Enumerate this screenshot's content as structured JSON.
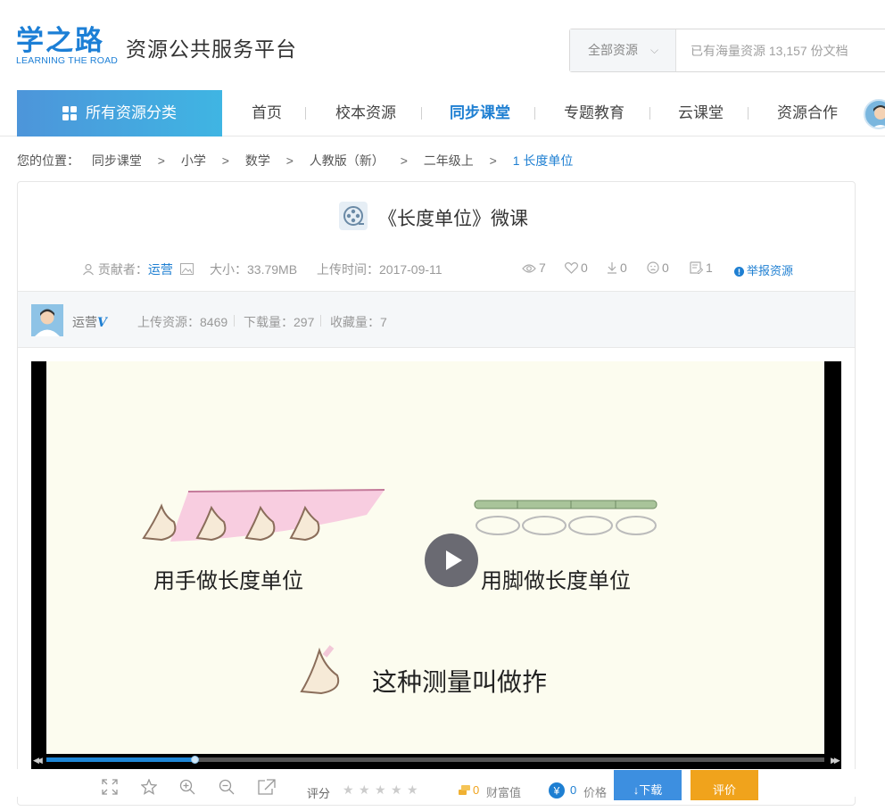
{
  "header": {
    "logo_cn": "学之路",
    "logo_en": "LEARNING THE ROAD",
    "platform_name": "资源公共服务平台",
    "search": {
      "scope": "全部资源",
      "placeholder": "已有海量资源 13,157 份文档"
    }
  },
  "nav": {
    "all_categories": "所有资源分类",
    "items": [
      {
        "label": "首页",
        "active": false
      },
      {
        "label": "校本资源",
        "active": false
      },
      {
        "label": "同步课堂",
        "active": true
      },
      {
        "label": "专题教育",
        "active": false
      },
      {
        "label": "云课堂",
        "active": false
      },
      {
        "label": "资源合作",
        "active": false
      }
    ]
  },
  "breadcrumb": {
    "prefix": "您的位置：",
    "items": [
      "同步课堂",
      "小学",
      "数学",
      "人教版（新）",
      "二年级上",
      "1 长度单位"
    ],
    "separator": ">"
  },
  "resource": {
    "title": "《长度单位》微课",
    "contributor_label": "贡献者：",
    "contributor": "运营",
    "size": "大小：33.79MB",
    "upload_time": "上传时间：2017-09-11",
    "stats": {
      "views": "7",
      "likes": "0",
      "downloads": "0",
      "dislikes": "0",
      "comments": "1"
    },
    "report": "举报资源"
  },
  "uploader": {
    "name": "运营",
    "badge": "V",
    "uploads": "上传资源：8469",
    "downloads": "下载量：297",
    "favorites": "收藏量：7"
  },
  "video": {
    "caption_hand": "用手做长度单位",
    "caption_foot": "用脚做长度单位",
    "caption_bottom": "这种测量叫做拃",
    "progress": 0.19
  },
  "toolbar": {
    "rating_label": "评分",
    "wealth": "0",
    "wealth_label": "财富值",
    "price": "0",
    "price_label": "价格",
    "download": "↓下载",
    "rate": "评价"
  },
  "colors": {
    "accent": "#1e7fd2",
    "nav_gradient_start": "#4d95da",
    "nav_gradient_end": "#3fb5e3",
    "download_button": "#3d8fe0",
    "rate_button": "#f0a31c"
  }
}
